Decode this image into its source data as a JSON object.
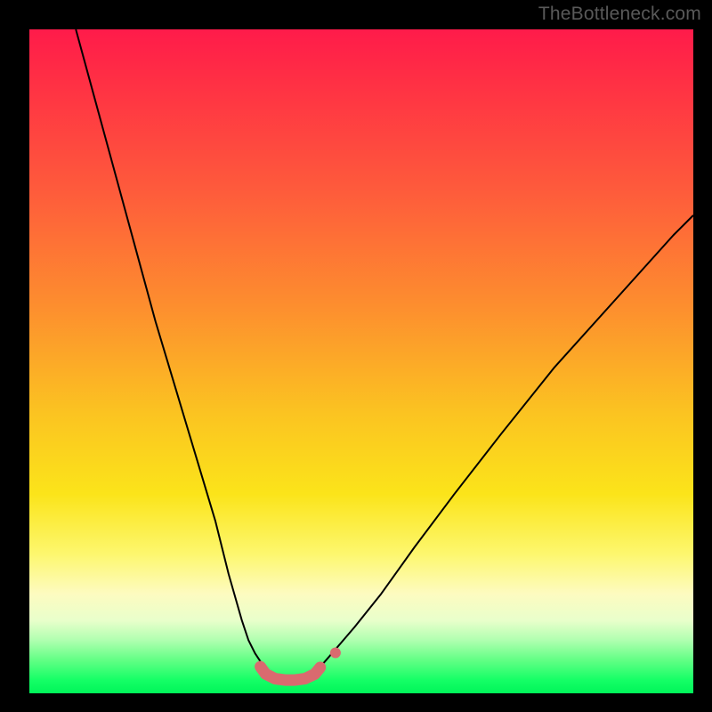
{
  "watermark": "TheBottleneck.com",
  "chart_data": {
    "type": "line",
    "title": "",
    "xlabel": "",
    "ylabel": "",
    "xlim": [
      0,
      100
    ],
    "ylim": [
      0,
      100
    ],
    "grid": false,
    "legend": false,
    "series": [
      {
        "name": "left-curve",
        "color": "#000000",
        "stroke_width": 2,
        "x": [
          7,
          10,
          13,
          16,
          19,
          22,
          25,
          28,
          30,
          32,
          33,
          34,
          35,
          36,
          36.5
        ],
        "values": [
          100,
          89,
          78,
          67,
          56,
          46,
          36,
          26,
          18,
          11,
          8,
          6,
          4.5,
          3.3,
          2.8
        ]
      },
      {
        "name": "right-curve",
        "color": "#000000",
        "stroke_width": 2,
        "x": [
          43,
          44,
          46,
          49,
          53,
          58,
          64,
          71,
          79,
          88,
          97,
          100
        ],
        "values": [
          3.2,
          4.2,
          6.5,
          10,
          15,
          22,
          30,
          39,
          49,
          59,
          69,
          72
        ]
      },
      {
        "name": "bottom-trough",
        "color": "#d96a6f",
        "stroke_width": 13,
        "linecap": "round",
        "x": [
          34.8,
          35.6,
          37.0,
          38.5,
          40.0,
          41.5,
          43.0,
          43.8
        ],
        "values": [
          4.0,
          2.9,
          2.2,
          2.0,
          2.0,
          2.2,
          2.9,
          3.9
        ]
      },
      {
        "name": "dot-right",
        "type": "scatter",
        "color": "#d96a6f",
        "radius": 6,
        "x": [
          46.1
        ],
        "values": [
          6.1
        ]
      }
    ]
  }
}
